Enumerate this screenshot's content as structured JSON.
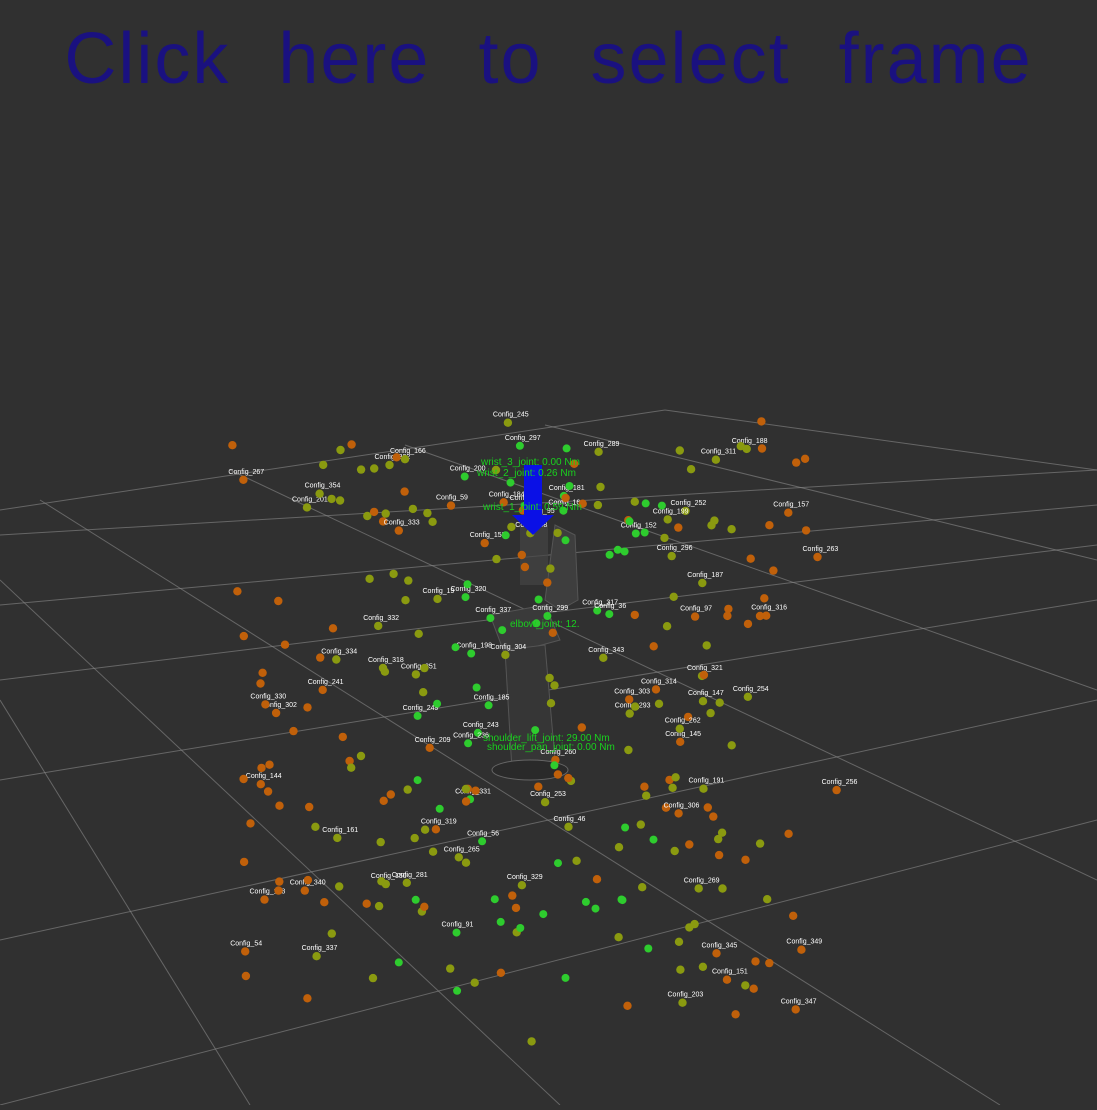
{
  "header": {
    "prompt": "Click here to select frame"
  },
  "colors": {
    "background": "#303030",
    "grid": "#8a8a8a",
    "prompt": "#1a1180",
    "torque_text": "#19d11e",
    "arrow": "#0a10e6",
    "sphere_good": "#2ecc2e",
    "sphere_mid": "#8a9a10",
    "sphere_bad": "#c0600a"
  },
  "torque_labels": [
    "wrist_3_joint: 0.00 Nm",
    "wrist_2_joint: 0.26 Nm",
    "wrist_1_joint: 0.59 Nm",
    "elbow_joint: 12.",
    "shoulder_lift_joint: 29.00 Nm",
    "shoulder_pan_joint: 0.00 Nm"
  ],
  "configs": [
    "Config_201",
    "Config_185",
    "Config_243",
    "Config_203",
    "Config_161",
    "Config_145",
    "Config_260",
    "Config_293",
    "Config_321",
    "Config_302",
    "Config_329",
    "Config_337",
    "Config_184",
    "Config_144",
    "Config_151",
    "Config_181",
    "Config_158",
    "Config_320",
    "Config_187",
    "Config_164",
    "Config_198",
    "Config_153",
    "Config_157",
    "Config_54",
    "Config_331",
    "Config_343",
    "Config_188",
    "Config_319",
    "Config_317",
    "Config_311",
    "Config_318",
    "Config_337",
    "Config_351",
    "Config_345",
    "Config_332",
    "Config_289",
    "Config_304",
    "Config_316",
    "Config_354",
    "Config_314",
    "Config_322",
    "Config_330",
    "Config_296",
    "Config_303",
    "Config_249",
    "Config_253",
    "Config_241",
    "Config_254",
    "Config_200",
    "Config_191",
    "Config_252",
    "Config_262",
    "Config_267",
    "Config_152",
    "Config_199",
    "Config_209",
    "Config_150",
    "Config_147",
    "Config_269",
    "Config_166",
    "Config_245",
    "Config_340",
    "Config_349",
    "Config_333",
    "Config_236",
    "Config_256",
    "Config_281",
    "Config_297",
    "Config_59",
    "Config_46",
    "Config_48",
    "Config_47",
    "Config_263",
    "Config_265",
    "Config_299",
    "Config_306",
    "Config_347",
    "Config_334",
    "Config_19",
    "Config_36",
    "Config_56",
    "Config_97",
    "Config_91",
    "Config_95"
  ]
}
